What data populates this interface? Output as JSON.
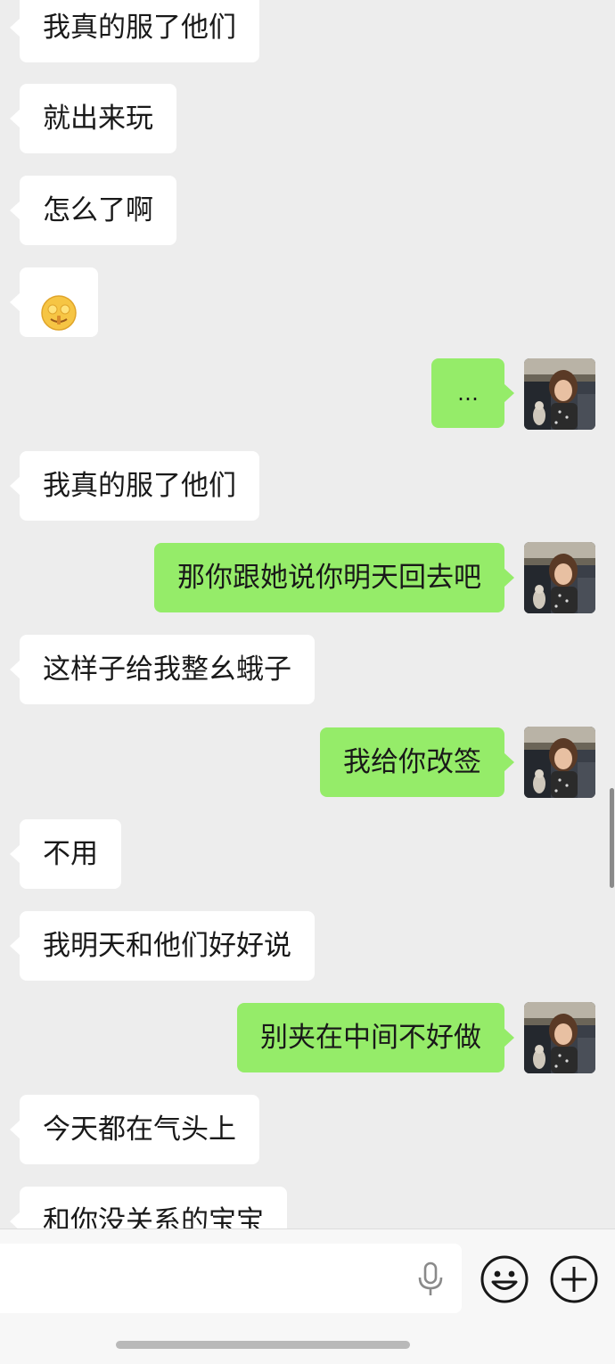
{
  "messages": [
    {
      "side": "in",
      "text": "我真的服了他们"
    },
    {
      "side": "in",
      "text": "就出来玩"
    },
    {
      "side": "in",
      "text": "怎么了啊"
    },
    {
      "side": "in",
      "type": "emoji",
      "icon": "money-mouth-face-emoji"
    },
    {
      "side": "out",
      "text": "…"
    },
    {
      "side": "in",
      "text": "我真的服了他们"
    },
    {
      "side": "out",
      "text": "那你跟她说你明天回去吧"
    },
    {
      "side": "in",
      "text": "这样子给我整幺蛾子"
    },
    {
      "side": "out",
      "text": "我给你改签"
    },
    {
      "side": "in",
      "text": "不用"
    },
    {
      "side": "in",
      "text": "我明天和他们好好说"
    },
    {
      "side": "out",
      "text": "别夹在中间不好做"
    },
    {
      "side": "in",
      "text": "今天都在气头上"
    },
    {
      "side": "in",
      "text": "和你没关系的宝宝"
    }
  ],
  "input_bar": {
    "placeholder": "",
    "icons": {
      "voice": "microphone-icon",
      "emoji": "smiley-icon",
      "more": "plus-circle-icon"
    }
  },
  "colors": {
    "background": "#ededed",
    "incoming_bubble": "#ffffff",
    "outgoing_bubble": "#95ec69",
    "text": "#191919"
  }
}
